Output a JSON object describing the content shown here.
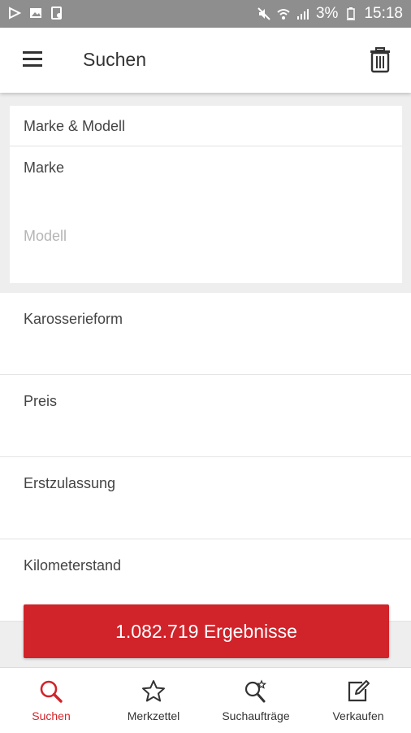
{
  "status_bar": {
    "battery": "3%",
    "time": "15:18"
  },
  "app_bar": {
    "title": "Suchen"
  },
  "form": {
    "section_header": "Marke & Modell",
    "marke_label": "Marke",
    "modell_placeholder": "Modell"
  },
  "filters": [
    "Karosserieform",
    "Preis",
    "Erstzulassung",
    "Kilometerstand"
  ],
  "results_button": "1.082.719 Ergebnisse",
  "bottom_nav": [
    {
      "label": "Suchen",
      "icon": "search-icon"
    },
    {
      "label": "Merkzettel",
      "icon": "star-icon"
    },
    {
      "label": "Suchaufträge",
      "icon": "saved-search-icon"
    },
    {
      "label": "Verkaufen",
      "icon": "edit-icon"
    }
  ],
  "colors": {
    "accent": "#d1232a",
    "status_bar": "#8e8e8e",
    "background": "#eeeeee"
  }
}
